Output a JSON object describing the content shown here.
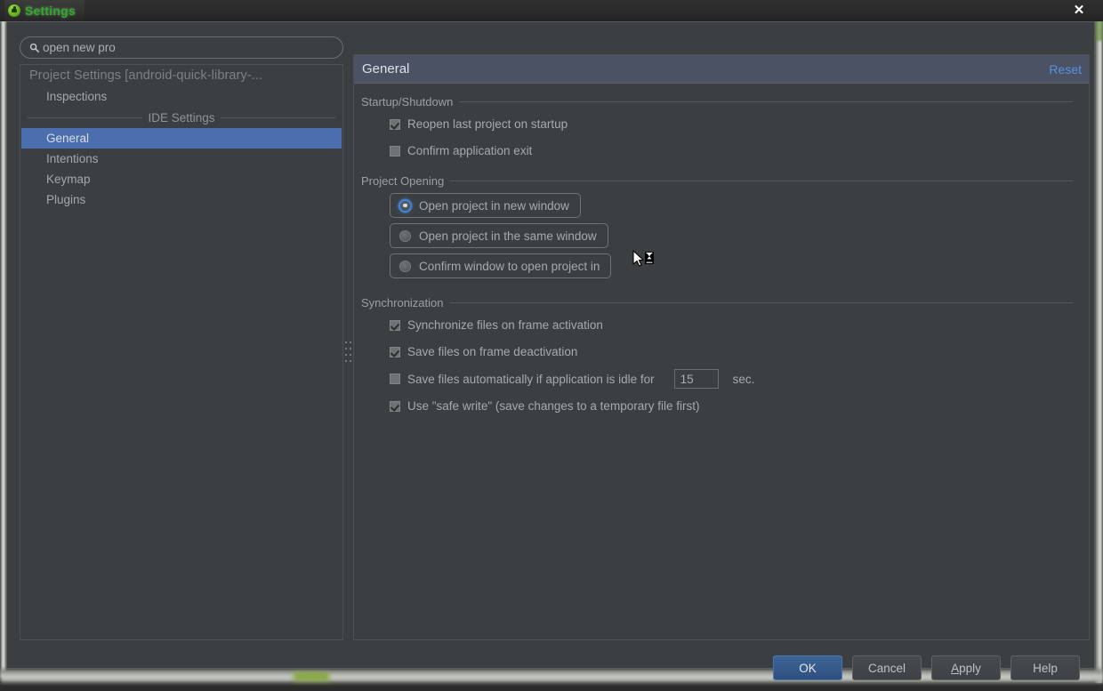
{
  "window": {
    "title": "Settings",
    "app_icon": "android-studio-icon",
    "close_label": "✕"
  },
  "search": {
    "value": "open new pro",
    "icon": "search-icon"
  },
  "tree": {
    "project_settings_label": "Project Settings [android-quick-library-...",
    "project_items": [
      {
        "label": "Inspections",
        "selected": false
      }
    ],
    "ide_separator_label": "IDE Settings",
    "ide_items": [
      {
        "label": "General",
        "selected": true
      },
      {
        "label": "Intentions",
        "selected": false
      },
      {
        "label": "Keymap",
        "selected": false
      },
      {
        "label": "Plugins",
        "selected": false
      }
    ]
  },
  "content": {
    "title": "General",
    "reset_label": "Reset",
    "sections": [
      {
        "title": "Startup/Shutdown",
        "checkboxes": [
          {
            "label": "Reopen last project on startup",
            "checked": true
          },
          {
            "label": "Confirm application exit",
            "checked": false
          }
        ]
      },
      {
        "title": "Project Opening",
        "radios": [
          {
            "label": "Open project in new window",
            "selected": true
          },
          {
            "label": "Open project in the same window",
            "selected": false
          },
          {
            "label": "Confirm window to open project in",
            "selected": false
          }
        ]
      },
      {
        "title": "Synchronization",
        "checkboxes": [
          {
            "label": "Synchronize files on frame activation",
            "checked": true
          },
          {
            "label": "Save files on frame deactivation",
            "checked": true
          }
        ],
        "idle_row": {
          "label": "Save files automatically if application is idle for",
          "checked": false,
          "value": "15",
          "unit": "sec."
        },
        "trailing_checkboxes": [
          {
            "label": "Use \"safe write\" (save changes to a temporary file first)",
            "checked": true
          }
        ]
      }
    ]
  },
  "buttons": {
    "ok": "OK",
    "cancel": "Cancel",
    "apply_mnemonic": "A",
    "apply_rest": "pply",
    "help": "Help"
  },
  "colors": {
    "accent_blue": "#4b6eaf",
    "header_blue": "#4a5263",
    "link_blue": "#5a92e0",
    "title_green": "#26b224",
    "panel_bg": "#3c3f41"
  }
}
